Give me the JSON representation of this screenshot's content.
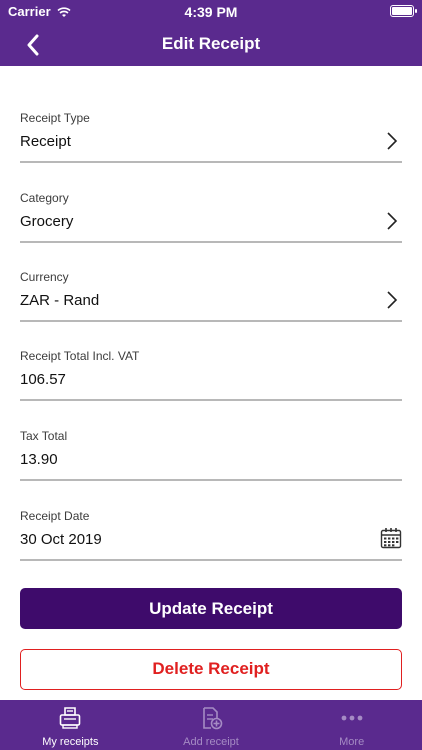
{
  "status_bar": {
    "carrier": "Carrier",
    "time": "4:39 PM"
  },
  "nav": {
    "title": "Edit Receipt",
    "back_icon": "chevron-left-icon"
  },
  "form": {
    "receipt_type": {
      "label": "Receipt Type",
      "value": "Receipt"
    },
    "category": {
      "label": "Category",
      "value": "Grocery"
    },
    "currency": {
      "label": "Currency",
      "value": "ZAR - Rand"
    },
    "total": {
      "label": "Receipt Total Incl. VAT",
      "value": "106.57"
    },
    "tax": {
      "label": "Tax Total",
      "value": "13.90"
    },
    "date": {
      "label": "Receipt Date",
      "value": "30 Oct 2019"
    }
  },
  "buttons": {
    "update": "Update Receipt",
    "delete": "Delete Receipt"
  },
  "tabs": [
    {
      "label": "My receipts",
      "icon": "receipt-printer-icon",
      "active": true
    },
    {
      "label": "Add receipt",
      "icon": "add-document-icon",
      "active": false
    },
    {
      "label": "More",
      "icon": "more-dots-icon",
      "active": false
    }
  ],
  "colors": {
    "brand": "#5a2a8e",
    "primary_button": "#3e0b6b",
    "danger": "#e02020"
  }
}
